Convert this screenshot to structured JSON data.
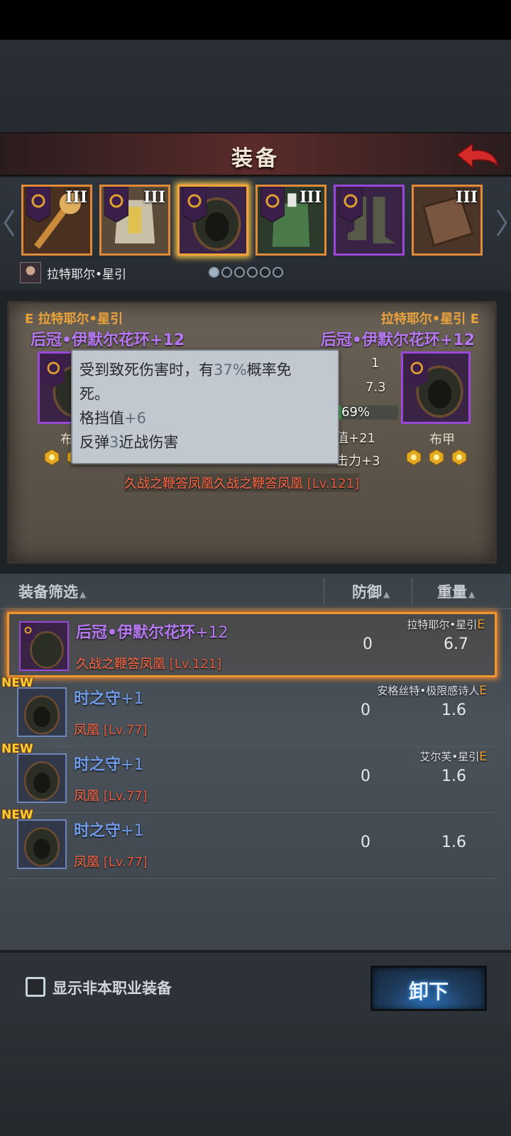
{
  "header": {
    "title": "装备"
  },
  "slots": [
    {
      "tier": "III",
      "rarity": "orange",
      "art": "staff"
    },
    {
      "tier": "III",
      "rarity": "orange",
      "art": "chest-plate"
    },
    {
      "tier": "",
      "rarity": "purple",
      "art": "hood",
      "selected": true
    },
    {
      "tier": "III",
      "rarity": "orange",
      "art": "armor"
    },
    {
      "tier": "",
      "rarity": "purple",
      "art": "boots"
    },
    {
      "tier": "III",
      "rarity": "orange",
      "art": "book"
    }
  ],
  "character": {
    "name": "拉特耶尔•星引"
  },
  "pager": {
    "count": 6,
    "active": 0
  },
  "compare": {
    "left": {
      "owner": "E 拉特耶尔•星引",
      "item": "后冠•伊默尔花环+12",
      "type": "布"
    },
    "right": {
      "owner": "拉特耶尔•星引 E",
      "item": "后冠•伊默尔花环+12",
      "type": "布甲"
    },
    "stats": {
      "s1": "1",
      "s2": "7.3",
      "bar_pct": "69%",
      "bar_fraction": 0.69,
      "s4": "值+21",
      "s5": "击力+3"
    },
    "set_line": "久战之鞭答凤凰久战之鞭答凤凰",
    "set_level": "[Lv.121]"
  },
  "tooltip": {
    "line1a": "受到致死伤害时，有",
    "line1num": "37%",
    "line1b": "概率免",
    "line2": "死。",
    "line3a": "格挡值",
    "line3num": "+6",
    "line4a": "反弹",
    "line4num": "3",
    "line4b": "近战伤害"
  },
  "list": {
    "headers": {
      "filter": "装备筛选",
      "defense": "防御",
      "weight": "重量"
    },
    "rows": [
      {
        "name": "后冠•伊默尔花环",
        "plus": "+12",
        "set": "久战之鞭答凤凰",
        "level": "[Lv.121]",
        "owner": "拉特耶尔•星引",
        "owner_tag": "E",
        "defense": "0",
        "weight": "6.7",
        "is_new": "",
        "selected": true
      },
      {
        "name": "时之守",
        "plus": "+1",
        "set": "凤凰",
        "level": "[Lv.77]",
        "owner": "安格丝特•极限感诗人",
        "owner_tag": "E",
        "defense": "0",
        "weight": "1.6",
        "is_new": "NEW"
      },
      {
        "name": "时之守",
        "plus": "+1",
        "set": "凤凰",
        "level": "[Lv.77]",
        "owner": "艾尔芙•星引",
        "owner_tag": "E",
        "defense": "0",
        "weight": "1.6",
        "is_new": "NEW"
      },
      {
        "name": "时之守",
        "plus": "+1",
        "set": "凤凰",
        "level": "[Lv.77]",
        "owner": "",
        "owner_tag": "",
        "defense": "0",
        "weight": "1.6",
        "is_new": "NEW"
      }
    ]
  },
  "bottom": {
    "checkbox_label": "显示非本职业装备",
    "unequip_label": "卸下"
  },
  "colors": {
    "orange_frame": "#e08a3a",
    "purple_frame": "#9a48d8",
    "set_red": "#ff6a48",
    "epic_name": "#b678f0",
    "rare_name": "#6f9be8"
  }
}
